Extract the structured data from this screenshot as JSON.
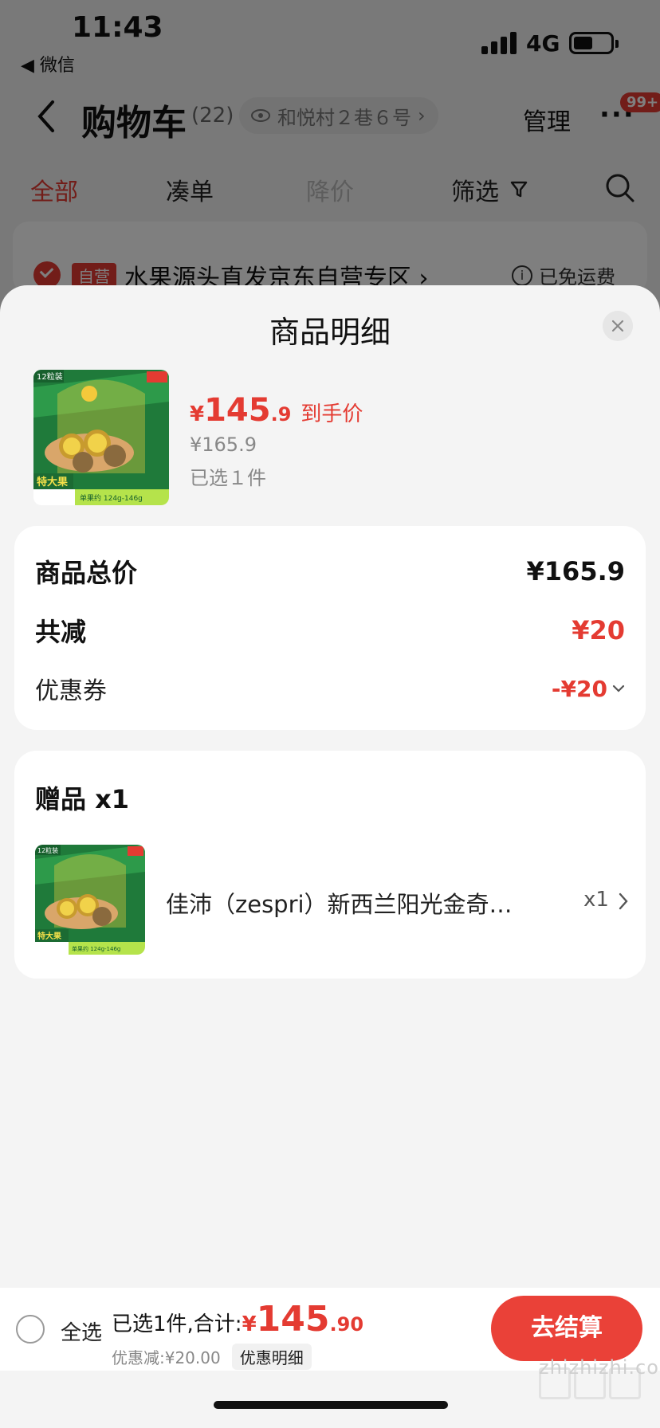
{
  "status_bar": {
    "time": "11:43",
    "back_app": "◀ 微信",
    "network": "4G",
    "battery_level": 0.45
  },
  "header": {
    "title": "购物车",
    "count": "(22)",
    "address": "和悦村２巷６号",
    "manage": "管理",
    "badge": "99+"
  },
  "tabs": [
    {
      "label": "全部",
      "state": "active"
    },
    {
      "label": "凑单",
      "state": "normal"
    },
    {
      "label": "降价",
      "state": "disabled"
    }
  ],
  "filter_label": "筛选",
  "shop": {
    "tag": "自营",
    "name": "水果源头直发京东自营专区 ›",
    "shipping": "已免运费"
  },
  "sheet": {
    "title": "商品明细",
    "product": {
      "price_symbol": "¥",
      "price_int": "145",
      "price_dec": ".9",
      "price_tag": "到手价",
      "original_price": "¥165.9",
      "selected": "已选１件",
      "image_badge": "12粒装",
      "image_corner": "特大果",
      "image_weight": "单果约 124g-146g"
    },
    "summary": {
      "total_label": "商品总价",
      "total_value": "¥165.9",
      "discount_label": "共减",
      "discount_value": "¥20",
      "coupon_label": "优惠券",
      "coupon_value": "-¥20"
    },
    "gift": {
      "title": "赠品 x1",
      "name": "佳沛（zespri）新西兰阳光金奇…",
      "qty": "x1"
    }
  },
  "checkout": {
    "select_all": "全选",
    "total_label": "已选1件,合计:",
    "total_symbol": "¥",
    "total_int": "145",
    "total_dec": ".90",
    "discount_text": "优惠减:¥20.00",
    "detail_button": "优惠明细",
    "checkout_button": "去结算"
  },
  "watermark": "zhizhizhi.com",
  "colors": {
    "accent": "#e43b32",
    "overlay": "rgba(0,0,0,0.5)",
    "sheet_bg": "#f4f4f4"
  }
}
